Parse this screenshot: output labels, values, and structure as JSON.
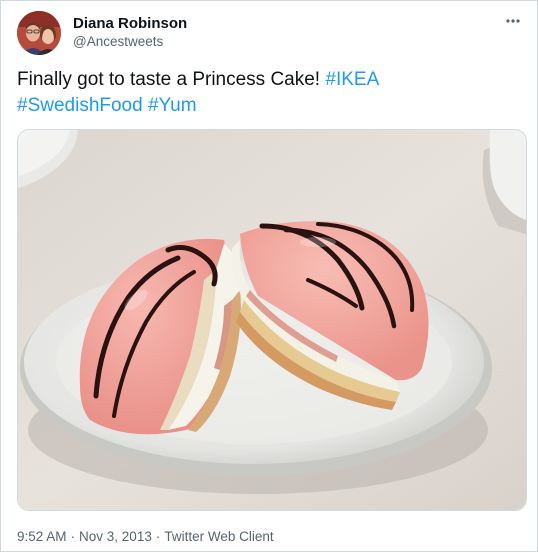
{
  "tweet": {
    "user": {
      "display_name": "Diana Robinson",
      "handle": "@Ancestweets",
      "avatar_icon": "profile-photo"
    },
    "more_icon": "more-dots-icon",
    "text_parts": {
      "plain": "Finally got to taste a Princess Cake! ",
      "hashtag_1": "#IKEA",
      "hashtag_2": "#SwedishFood",
      "hashtag_3": "#Yum"
    },
    "media": {
      "kind": "photo"
    },
    "meta": {
      "time": "9:52 AM",
      "separator": "·",
      "date": "Nov 3, 2013",
      "client": "Twitter Web Client"
    }
  },
  "colors": {
    "text": "#0f1419",
    "secondary": "#536471",
    "link": "#1d9bf0",
    "border": "#cfd9de",
    "cake_pink": "#f3a6a0",
    "chocolate": "#2a1210"
  }
}
